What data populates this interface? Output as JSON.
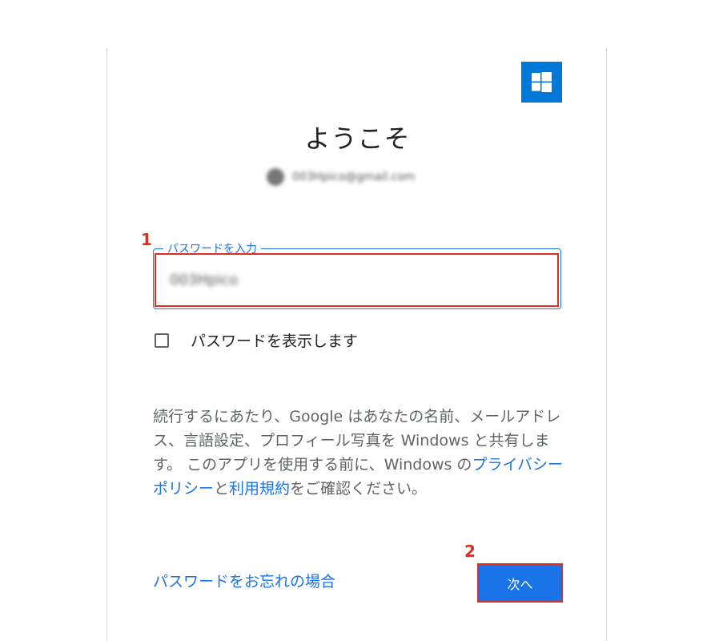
{
  "heading": "ようこそ",
  "account": {
    "email": "003Hpico@gmail.com"
  },
  "password_field": {
    "label": "パスワードを入力",
    "value": "003Hpico"
  },
  "show_password_label": "パスワードを表示します",
  "consent": {
    "part1": "続行するにあたり、Google はあなたの名前、メールアドレス、言語設定、プロフィール写真を Windows と共有します。 このアプリを使用する前に、Windows の",
    "privacy_link": "プライバシー ポリシー",
    "part2": "と",
    "terms_link": "利用規約",
    "part3": "をご確認ください。"
  },
  "forgot_password_link": "パスワードをお忘れの場合",
  "next_button": "次へ",
  "callouts": {
    "one": "1",
    "two": "2"
  },
  "colors": {
    "accent": "#1a73e8",
    "windows_blue": "#0078d7",
    "callout_red": "#d93025"
  },
  "icons": {
    "brand": "windows-logo-icon",
    "checkbox": "checkbox-icon"
  }
}
